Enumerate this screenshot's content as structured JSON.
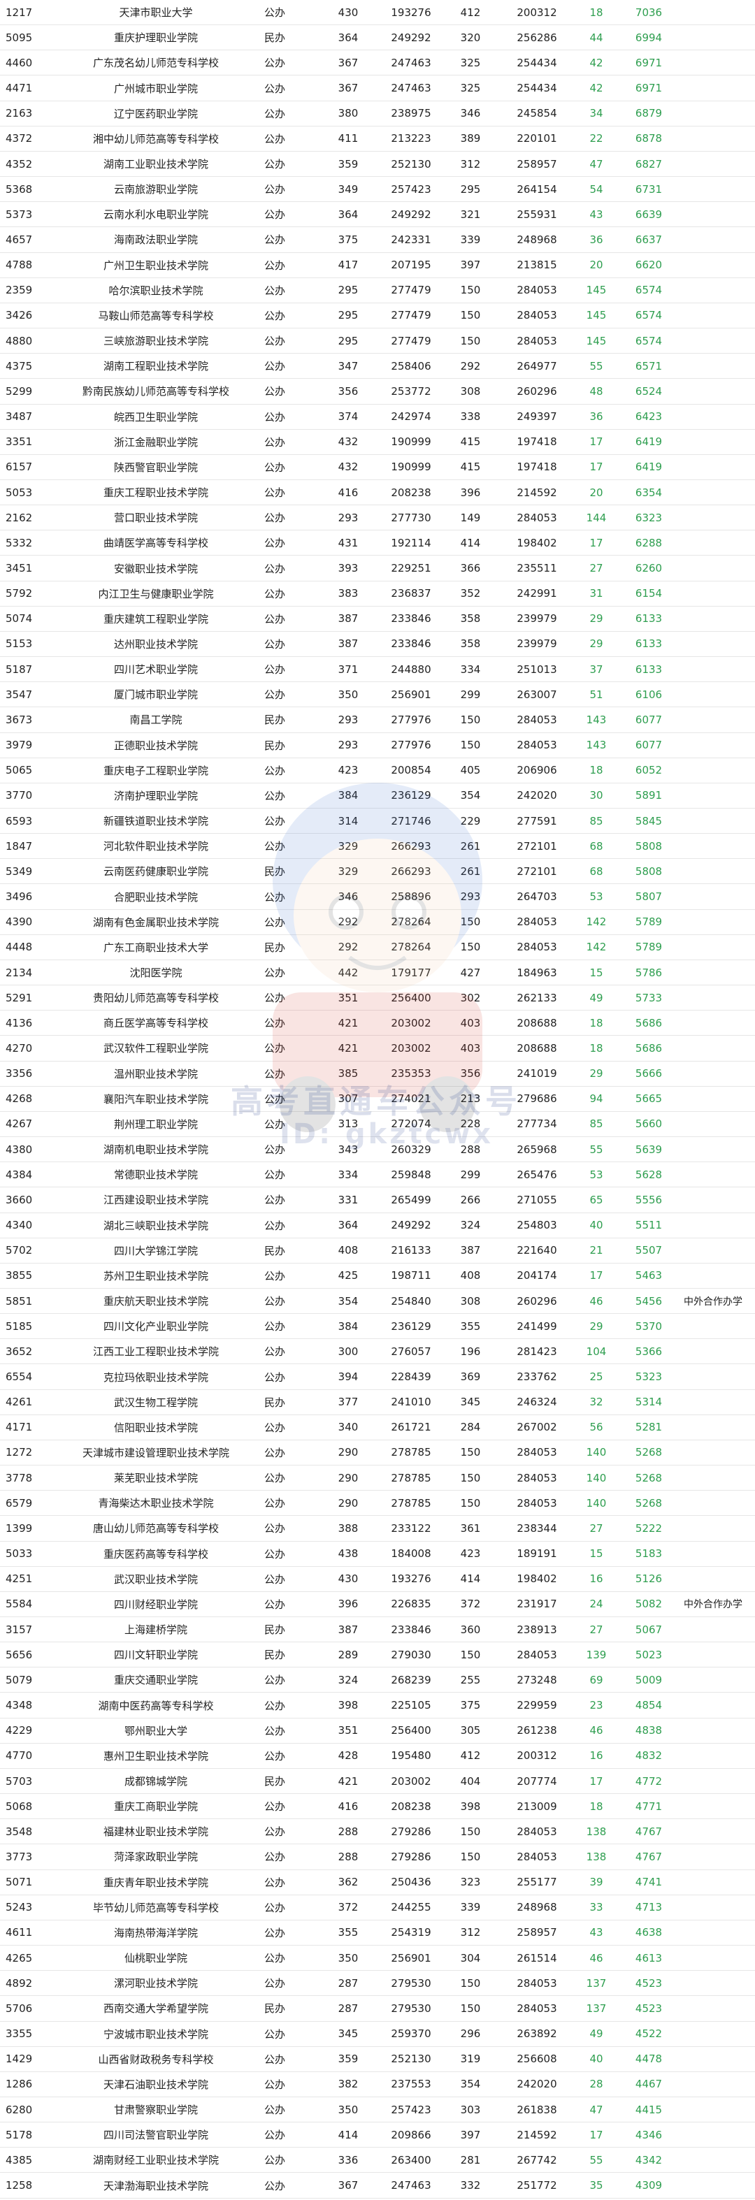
{
  "watermark": {
    "line1": "高考直通车公众号",
    "line2": "ID: gkztcwx"
  },
  "rows": [
    [
      "1217",
      "天津市职业大学",
      "公办",
      "430",
      "193276",
      "412",
      "200312",
      "18",
      "7036",
      ""
    ],
    [
      "5095",
      "重庆护理职业学院",
      "民办",
      "364",
      "249292",
      "320",
      "256286",
      "44",
      "6994",
      ""
    ],
    [
      "4460",
      "广东茂名幼儿师范专科学校",
      "公办",
      "367",
      "247463",
      "325",
      "254434",
      "42",
      "6971",
      ""
    ],
    [
      "4471",
      "广州城市职业学院",
      "公办",
      "367",
      "247463",
      "325",
      "254434",
      "42",
      "6971",
      ""
    ],
    [
      "2163",
      "辽宁医药职业学院",
      "公办",
      "380",
      "238975",
      "346",
      "245854",
      "34",
      "6879",
      ""
    ],
    [
      "4372",
      "湘中幼儿师范高等专科学校",
      "公办",
      "411",
      "213223",
      "389",
      "220101",
      "22",
      "6878",
      ""
    ],
    [
      "4352",
      "湖南工业职业技术学院",
      "公办",
      "359",
      "252130",
      "312",
      "258957",
      "47",
      "6827",
      ""
    ],
    [
      "5368",
      "云南旅游职业学院",
      "公办",
      "349",
      "257423",
      "295",
      "264154",
      "54",
      "6731",
      ""
    ],
    [
      "5373",
      "云南水利水电职业学院",
      "公办",
      "364",
      "249292",
      "321",
      "255931",
      "43",
      "6639",
      ""
    ],
    [
      "4657",
      "海南政法职业学院",
      "公办",
      "375",
      "242331",
      "339",
      "248968",
      "36",
      "6637",
      ""
    ],
    [
      "4788",
      "广州卫生职业技术学院",
      "公办",
      "417",
      "207195",
      "397",
      "213815",
      "20",
      "6620",
      ""
    ],
    [
      "2359",
      "哈尔滨职业技术学院",
      "公办",
      "295",
      "277479",
      "150",
      "284053",
      "145",
      "6574",
      ""
    ],
    [
      "3426",
      "马鞍山师范高等专科学校",
      "公办",
      "295",
      "277479",
      "150",
      "284053",
      "145",
      "6574",
      ""
    ],
    [
      "4880",
      "三峡旅游职业技术学院",
      "公办",
      "295",
      "277479",
      "150",
      "284053",
      "145",
      "6574",
      ""
    ],
    [
      "4375",
      "湖南工程职业技术学院",
      "公办",
      "347",
      "258406",
      "292",
      "264977",
      "55",
      "6571",
      ""
    ],
    [
      "5299",
      "黔南民族幼儿师范高等专科学校",
      "公办",
      "356",
      "253772",
      "308",
      "260296",
      "48",
      "6524",
      ""
    ],
    [
      "3487",
      "皖西卫生职业学院",
      "公办",
      "374",
      "242974",
      "338",
      "249397",
      "36",
      "6423",
      ""
    ],
    [
      "3351",
      "浙江金融职业学院",
      "公办",
      "432",
      "190999",
      "415",
      "197418",
      "17",
      "6419",
      ""
    ],
    [
      "6157",
      "陕西警官职业学院",
      "公办",
      "432",
      "190999",
      "415",
      "197418",
      "17",
      "6419",
      ""
    ],
    [
      "5053",
      "重庆工程职业技术学院",
      "公办",
      "416",
      "208238",
      "396",
      "214592",
      "20",
      "6354",
      ""
    ],
    [
      "2162",
      "营口职业技术学院",
      "公办",
      "293",
      "277730",
      "149",
      "284053",
      "144",
      "6323",
      ""
    ],
    [
      "5332",
      "曲靖医学高等专科学校",
      "公办",
      "431",
      "192114",
      "414",
      "198402",
      "17",
      "6288",
      ""
    ],
    [
      "3451",
      "安徽职业技术学院",
      "公办",
      "393",
      "229251",
      "366",
      "235511",
      "27",
      "6260",
      ""
    ],
    [
      "5792",
      "内江卫生与健康职业学院",
      "公办",
      "383",
      "236837",
      "352",
      "242991",
      "31",
      "6154",
      ""
    ],
    [
      "5074",
      "重庆建筑工程职业学院",
      "公办",
      "387",
      "233846",
      "358",
      "239979",
      "29",
      "6133",
      ""
    ],
    [
      "5153",
      "达州职业技术学院",
      "公办",
      "387",
      "233846",
      "358",
      "239979",
      "29",
      "6133",
      ""
    ],
    [
      "5187",
      "四川艺术职业学院",
      "公办",
      "371",
      "244880",
      "334",
      "251013",
      "37",
      "6133",
      ""
    ],
    [
      "3547",
      "厦门城市职业学院",
      "公办",
      "350",
      "256901",
      "299",
      "263007",
      "51",
      "6106",
      ""
    ],
    [
      "3673",
      "南昌工学院",
      "民办",
      "293",
      "277976",
      "150",
      "284053",
      "143",
      "6077",
      ""
    ],
    [
      "3979",
      "正德职业技术学院",
      "民办",
      "293",
      "277976",
      "150",
      "284053",
      "143",
      "6077",
      ""
    ],
    [
      "5065",
      "重庆电子工程职业学院",
      "公办",
      "423",
      "200854",
      "405",
      "206906",
      "18",
      "6052",
      ""
    ],
    [
      "3770",
      "济南护理职业学院",
      "公办",
      "384",
      "236129",
      "354",
      "242020",
      "30",
      "5891",
      ""
    ],
    [
      "6593",
      "新疆铁道职业技术学院",
      "公办",
      "314",
      "271746",
      "229",
      "277591",
      "85",
      "5845",
      ""
    ],
    [
      "1847",
      "河北软件职业技术学院",
      "公办",
      "329",
      "266293",
      "261",
      "272101",
      "68",
      "5808",
      ""
    ],
    [
      "5349",
      "云南医药健康职业学院",
      "民办",
      "329",
      "266293",
      "261",
      "272101",
      "68",
      "5808",
      ""
    ],
    [
      "3496",
      "合肥职业技术学院",
      "公办",
      "346",
      "258896",
      "293",
      "264703",
      "53",
      "5807",
      ""
    ],
    [
      "4390",
      "湖南有色金属职业技术学院",
      "公办",
      "292",
      "278264",
      "150",
      "284053",
      "142",
      "5789",
      ""
    ],
    [
      "4448",
      "广东工商职业技术大学",
      "民办",
      "292",
      "278264",
      "150",
      "284053",
      "142",
      "5789",
      ""
    ],
    [
      "2134",
      "沈阳医学院",
      "公办",
      "442",
      "179177",
      "427",
      "184963",
      "15",
      "5786",
      ""
    ],
    [
      "5291",
      "贵阳幼儿师范高等专科学校",
      "公办",
      "351",
      "256400",
      "302",
      "262133",
      "49",
      "5733",
      ""
    ],
    [
      "4136",
      "商丘医学高等专科学校",
      "公办",
      "421",
      "203002",
      "403",
      "208688",
      "18",
      "5686",
      ""
    ],
    [
      "4270",
      "武汉软件工程职业学院",
      "公办",
      "421",
      "203002",
      "403",
      "208688",
      "18",
      "5686",
      ""
    ],
    [
      "3356",
      "温州职业技术学院",
      "公办",
      "385",
      "235353",
      "356",
      "241019",
      "29",
      "5666",
      ""
    ],
    [
      "4268",
      "襄阳汽车职业技术学院",
      "公办",
      "307",
      "274021",
      "213",
      "279686",
      "94",
      "5665",
      ""
    ],
    [
      "4267",
      "荆州理工职业学院",
      "公办",
      "313",
      "272074",
      "228",
      "277734",
      "85",
      "5660",
      ""
    ],
    [
      "4380",
      "湖南机电职业技术学院",
      "公办",
      "343",
      "260329",
      "288",
      "265968",
      "55",
      "5639",
      ""
    ],
    [
      "4384",
      "常德职业技术学院",
      "公办",
      "334",
      "259848",
      "299",
      "265476",
      "53",
      "5628",
      ""
    ],
    [
      "3660",
      "江西建设职业技术学院",
      "公办",
      "331",
      "265499",
      "266",
      "271055",
      "65",
      "5556",
      ""
    ],
    [
      "4340",
      "湖北三峡职业技术学院",
      "公办",
      "364",
      "249292",
      "324",
      "254803",
      "40",
      "5511",
      ""
    ],
    [
      "5702",
      "四川大学锦江学院",
      "民办",
      "408",
      "216133",
      "387",
      "221640",
      "21",
      "5507",
      ""
    ],
    [
      "3855",
      "苏州卫生职业技术学院",
      "公办",
      "425",
      "198711",
      "408",
      "204174",
      "17",
      "5463",
      ""
    ],
    [
      "5851",
      "重庆航天职业技术学院",
      "公办",
      "354",
      "254840",
      "308",
      "260296",
      "46",
      "5456",
      "中外合作办学"
    ],
    [
      "5185",
      "四川文化产业职业学院",
      "公办",
      "384",
      "236129",
      "355",
      "241499",
      "29",
      "5370",
      ""
    ],
    [
      "3652",
      "江西工业工程职业技术学院",
      "公办",
      "300",
      "276057",
      "196",
      "281423",
      "104",
      "5366",
      ""
    ],
    [
      "6554",
      "克拉玛依职业技术学院",
      "公办",
      "394",
      "228439",
      "369",
      "233762",
      "25",
      "5323",
      ""
    ],
    [
      "4261",
      "武汉生物工程学院",
      "民办",
      "377",
      "241010",
      "345",
      "246324",
      "32",
      "5314",
      ""
    ],
    [
      "4171",
      "信阳职业技术学院",
      "公办",
      "340",
      "261721",
      "284",
      "267002",
      "56",
      "5281",
      ""
    ],
    [
      "1272",
      "天津城市建设管理职业技术学院",
      "公办",
      "290",
      "278785",
      "150",
      "284053",
      "140",
      "5268",
      ""
    ],
    [
      "3778",
      "莱芜职业技术学院",
      "公办",
      "290",
      "278785",
      "150",
      "284053",
      "140",
      "5268",
      ""
    ],
    [
      "6579",
      "青海柴达木职业技术学院",
      "公办",
      "290",
      "278785",
      "150",
      "284053",
      "140",
      "5268",
      ""
    ],
    [
      "1399",
      "唐山幼儿师范高等专科学校",
      "公办",
      "388",
      "233122",
      "361",
      "238344",
      "27",
      "5222",
      ""
    ],
    [
      "5033",
      "重庆医药高等专科学校",
      "公办",
      "438",
      "184008",
      "423",
      "189191",
      "15",
      "5183",
      ""
    ],
    [
      "4251",
      "武汉职业技术学院",
      "公办",
      "430",
      "193276",
      "414",
      "198402",
      "16",
      "5126",
      ""
    ],
    [
      "5584",
      "四川财经职业学院",
      "公办",
      "396",
      "226835",
      "372",
      "231917",
      "24",
      "5082",
      "中外合作办学"
    ],
    [
      "3157",
      "上海建桥学院",
      "民办",
      "387",
      "233846",
      "360",
      "238913",
      "27",
      "5067",
      ""
    ],
    [
      "5656",
      "四川文轩职业学院",
      "民办",
      "289",
      "279030",
      "150",
      "284053",
      "139",
      "5023",
      ""
    ],
    [
      "5079",
      "重庆交通职业学院",
      "公办",
      "324",
      "268239",
      "255",
      "273248",
      "69",
      "5009",
      ""
    ],
    [
      "4348",
      "湖南中医药高等专科学校",
      "公办",
      "398",
      "225105",
      "375",
      "229959",
      "23",
      "4854",
      ""
    ],
    [
      "4229",
      "鄂州职业大学",
      "公办",
      "351",
      "256400",
      "305",
      "261238",
      "46",
      "4838",
      ""
    ],
    [
      "4770",
      "惠州卫生职业技术学院",
      "公办",
      "428",
      "195480",
      "412",
      "200312",
      "16",
      "4832",
      ""
    ],
    [
      "5703",
      "成都锦城学院",
      "民办",
      "421",
      "203002",
      "404",
      "207774",
      "17",
      "4772",
      ""
    ],
    [
      "5068",
      "重庆工商职业学院",
      "公办",
      "416",
      "208238",
      "398",
      "213009",
      "18",
      "4771",
      ""
    ],
    [
      "3548",
      "福建林业职业技术学院",
      "公办",
      "288",
      "279286",
      "150",
      "284053",
      "138",
      "4767",
      ""
    ],
    [
      "3773",
      "菏泽家政职业学院",
      "公办",
      "288",
      "279286",
      "150",
      "284053",
      "138",
      "4767",
      ""
    ],
    [
      "5071",
      "重庆青年职业技术学院",
      "公办",
      "362",
      "250436",
      "323",
      "255177",
      "39",
      "4741",
      ""
    ],
    [
      "5243",
      "毕节幼儿师范高等专科学校",
      "公办",
      "372",
      "244255",
      "339",
      "248968",
      "33",
      "4713",
      ""
    ],
    [
      "4611",
      "海南热带海洋学院",
      "公办",
      "355",
      "254319",
      "312",
      "258957",
      "43",
      "4638",
      ""
    ],
    [
      "4265",
      "仙桃职业学院",
      "公办",
      "350",
      "256901",
      "304",
      "261514",
      "46",
      "4613",
      ""
    ],
    [
      "4892",
      "漯河职业技术学院",
      "公办",
      "287",
      "279530",
      "150",
      "284053",
      "137",
      "4523",
      ""
    ],
    [
      "5706",
      "西南交通大学希望学院",
      "民办",
      "287",
      "279530",
      "150",
      "284053",
      "137",
      "4523",
      ""
    ],
    [
      "3355",
      "宁波城市职业技术学院",
      "公办",
      "345",
      "259370",
      "296",
      "263892",
      "49",
      "4522",
      ""
    ],
    [
      "1429",
      "山西省财政税务专科学校",
      "公办",
      "359",
      "252130",
      "319",
      "256608",
      "40",
      "4478",
      ""
    ],
    [
      "1286",
      "天津石油职业技术学院",
      "公办",
      "382",
      "237553",
      "354",
      "242020",
      "28",
      "4467",
      ""
    ],
    [
      "6280",
      "甘肃警察职业学院",
      "公办",
      "350",
      "257423",
      "303",
      "261838",
      "47",
      "4415",
      ""
    ],
    [
      "5178",
      "四川司法警官职业学院",
      "公办",
      "414",
      "209866",
      "397",
      "214592",
      "17",
      "4346",
      ""
    ],
    [
      "4385",
      "湖南财经工业职业技术学院",
      "公办",
      "336",
      "263400",
      "281",
      "267742",
      "55",
      "4342",
      ""
    ],
    [
      "1258",
      "天津渤海职业技术学院",
      "公办",
      "367",
      "247463",
      "332",
      "251772",
      "35",
      "4309",
      ""
    ]
  ]
}
